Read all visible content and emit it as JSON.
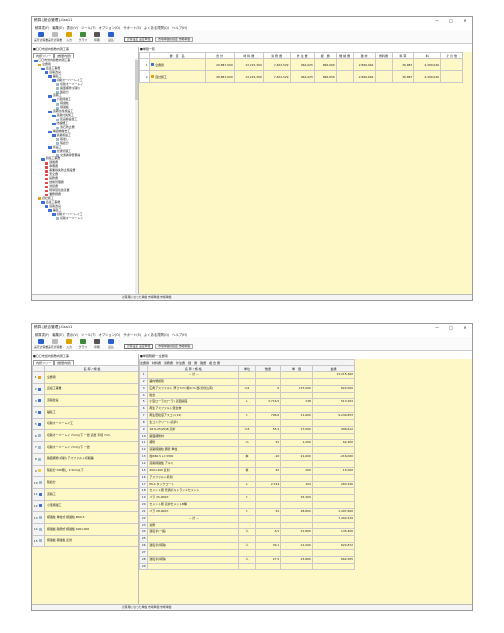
{
  "app": {
    "title": "積算-[統合管理]-Gsa11",
    "window_controls": [
      "—",
      "□",
      "✕"
    ],
    "menu": [
      "積算書(F)",
      "編集(E)",
      "表示(V)",
      "ツール(T)",
      "オプション(O)",
      "サポート(S)",
      "よくある質問(Q)",
      "ヘルプ(H)"
    ],
    "toolbar": [
      {
        "label": "実行計算書",
        "icon": "calc-icon"
      },
      {
        "label": "実行計算書",
        "icon": "undo-icon"
      },
      {
        "label": "入力",
        "icon": "pencil-icon"
      },
      {
        "label": "グラフ",
        "icon": "graph-icon"
      },
      {
        "label": "印刷",
        "icon": "print-icon"
      },
      {
        "label": "読込",
        "icon": "load-icon"
      }
    ],
    "box1": "計算設定\n設定単価",
    "box2": "市場単価の指定\n市場単価",
    "status": "計算用になった単価  市場単価  市場単価"
  },
  "left": {
    "header": "■〇〇市営内旗敷内測工事",
    "tab1": "内訳ツリー",
    "tab2": "[数量内訳]",
    "tree": [
      {
        "t": "〇〇市営内旗敷内測工事",
        "d": 0,
        "c": "c-blue"
      },
      {
        "t": "全費用",
        "d": 1,
        "c": "c-or"
      },
      {
        "t": "直接工事費",
        "d": 2,
        "c": "c-blue"
      },
      {
        "t": "道路改良",
        "d": 3,
        "c": "c-blue"
      },
      {
        "t": "舗装工",
        "d": 4,
        "c": "c-blue"
      },
      {
        "t": "切削オーバーレイ工",
        "d": 5,
        "c": "c-blue"
      },
      {
        "t": "切削オーバーレイ",
        "d": 6,
        "c": "c-gr"
      },
      {
        "t": "路面補修(切削)",
        "d": 6,
        "c": "c-gr"
      },
      {
        "t": "殻処分",
        "d": 6,
        "c": "c-gr"
      },
      {
        "t": "道路工",
        "d": 4,
        "c": "c-blue"
      },
      {
        "t": "小型標識工",
        "d": 5,
        "c": "c-blue"
      },
      {
        "t": "標識柱",
        "d": 6,
        "c": "c-gr"
      },
      {
        "t": "標識板",
        "d": 6,
        "c": "c-gr"
      },
      {
        "t": "道路付属施設工",
        "d": 4,
        "c": "c-blue"
      },
      {
        "t": "道路付属施工",
        "d": 5,
        "c": "c-blue"
      },
      {
        "t": "区画線設置工",
        "d": 6,
        "c": "c-gr"
      },
      {
        "t": "防護柵工",
        "d": 5,
        "c": "c-blue"
      },
      {
        "t": "落石防止柵",
        "d": 6,
        "c": "c-gr"
      },
      {
        "t": "構造物撤去工",
        "d": 4,
        "c": "c-blue"
      },
      {
        "t": "道路施設工",
        "d": 5,
        "c": "c-blue"
      },
      {
        "t": "取壊し",
        "d": 6,
        "c": "c-gr"
      },
      {
        "t": "殻処分",
        "d": 6,
        "c": "c-gr"
      },
      {
        "t": "仮設工",
        "d": 4,
        "c": "c-blue"
      },
      {
        "t": "交通管理工",
        "d": 5,
        "c": "c-blue"
      },
      {
        "t": "交通誘導警備員",
        "d": 6,
        "c": "c-gr"
      },
      {
        "t": "間接工事費",
        "d": 2,
        "c": "c-blue"
      },
      {
        "t": "運搬費",
        "d": 3,
        "c": "c-red"
      },
      {
        "t": "準備費",
        "d": 3,
        "c": "c-red"
      },
      {
        "t": "事業損失防止施設費",
        "d": 3,
        "c": "c-red"
      },
      {
        "t": "安全費",
        "d": 3,
        "c": "c-red"
      },
      {
        "t": "役務費",
        "d": 3,
        "c": "c-red"
      },
      {
        "t": "技術管理費",
        "d": 3,
        "c": "c-red"
      },
      {
        "t": "営繕費",
        "d": 3,
        "c": "c-red"
      },
      {
        "t": "現場環境改善費",
        "d": 3,
        "c": "c-red"
      },
      {
        "t": "業務経費",
        "d": 3,
        "c": "c-red"
      },
      {
        "t": "自社施工",
        "d": 1,
        "c": "c-or"
      },
      {
        "t": "直接工事費",
        "d": 2,
        "c": "c-blue"
      },
      {
        "t": "道路改良",
        "d": 3,
        "c": "c-blue"
      },
      {
        "t": "舗装工",
        "d": 4,
        "c": "c-blue"
      },
      {
        "t": "切削オーバーレイ工",
        "d": 5,
        "c": "c-blue"
      },
      {
        "t": "切削オーバーレイ",
        "d": 6,
        "c": "c-gr"
      }
    ]
  },
  "grid1": {
    "header": "■単価一覧",
    "cols": [
      "費　目　名",
      "合 計",
      "材 料 費",
      "労 務 費",
      "外 注 費",
      "経　費",
      "機 械 費",
      "雑 材",
      "燃料費",
      "料 算",
      "料",
      "そ の 他"
    ],
    "rows": [
      {
        "no": "1",
        "name": "全費用",
        "v": [
          "29,887,009",
          "13,215,300",
          "7,402,529",
          "962,625",
          "896,669",
          "",
          "2,896,662",
          "",
          "36,887",
          "4,399,040",
          ""
        ]
      },
      {
        "no": "2",
        "name": "自社施工",
        "v": [
          "28,887,009",
          "13,215,300",
          "7,402,529",
          "962,625",
          "896,659",
          "",
          "2,896,662",
          "",
          "36,887",
          "4,399,040",
          ""
        ]
      }
    ]
  },
  "w2": {
    "left_header": "■〇〇市営内旗敷内測工事",
    "right_header": "■単価明細一 全費用",
    "left_cols": [
      "名 称 / 規 格"
    ],
    "left_rows": [
      {
        "no": "1",
        "t": "全費用",
        "c": "c-or"
      },
      {
        "no": "2",
        "t": "直接工事費",
        "c": "c-blue"
      },
      {
        "no": "3",
        "t": "道路改良",
        "c": "c-blue"
      },
      {
        "no": "4",
        "t": "舗装工",
        "c": "c-blue"
      },
      {
        "no": "5",
        "t": "切削オーバーレイ工",
        "c": "c-blue"
      },
      {
        "no": "6",
        "t": "切削オーバーレイ 7cm以下 一層 表層 平坦 7cm",
        "c": "c-gr"
      },
      {
        "no": "7",
        "t": "切削オーバーレイ 7cm以下 一層",
        "c": "c-gr"
      },
      {
        "no": "8",
        "t": "路面補修(切削) アスファルト切削舗",
        "c": "c-gr"
      },
      {
        "no": "9",
        "t": "殻処分 DID無し 1.5km以下",
        "c": "c-yl"
      },
      {
        "no": "10",
        "t": "殻処分",
        "c": "c-gr"
      },
      {
        "no": "11",
        "t": "道路工",
        "c": "c-blue"
      },
      {
        "no": "12",
        "t": "小型標識工",
        "c": "c-blue"
      },
      {
        "no": "13",
        "t": "標識柱 単柱式 標識柱 Φ60.5",
        "c": "c-gr"
      },
      {
        "no": "14",
        "t": "標識板 路側式 標識板 400×400",
        "c": "c-gr"
      },
      {
        "no": "15",
        "t": "標識板 標識板 反射",
        "c": "c-gr"
      }
    ],
    "right_cols": [
      "全費用",
      "材料費",
      "労務費",
      "外注費",
      "経　費",
      "雑費",
      "複 合 費",
      "",
      "名 称 / 規 格",
      "単位",
      "数量",
      "単　価",
      "金額"
    ],
    "rows": [
      {
        "no": "1",
        "nm": "－ 計 －",
        "u": "",
        "q": "",
        "p": "",
        "a": "13,215,300"
      },
      {
        "no": "2",
        "nm": "舗内規模別",
        "u": "",
        "q": "",
        "p": "",
        "a": ""
      },
      {
        "no": "3",
        "nm": "広角アスファルト 厚さ7cm 幅2cm 層(切付込有)",
        "u": "m2",
        "q": "6",
        "p": "137,000",
        "a": "822,000"
      },
      {
        "no": "4",
        "nm": "粒合",
        "u": "",
        "q": "",
        "p": "",
        "a": ""
      },
      {
        "no": "5",
        "nm": "小型ローラ(ローラ) 表面締固",
        "u": "L",
        "q": "3,716.5",
        "p": "138",
        "a": "513,293"
      },
      {
        "no": "6",
        "nm": "再生アスファルト混合物",
        "u": "",
        "q": "",
        "p": "",
        "a": ""
      },
      {
        "no": "7",
        "nm": "再生密粒度アスコン(13)",
        "u": "t",
        "q": "796.6",
        "p": "11,600",
        "a": "9,240,853"
      },
      {
        "no": "8",
        "nm": "生コンクリート(高炉)",
        "u": "",
        "q": "",
        "p": "",
        "a": ""
      },
      {
        "no": "9",
        "nm": "18-8-25(20)B 高炉",
        "u": "m3",
        "q": "55.4",
        "p": "17,000",
        "a": "996,612"
      },
      {
        "no": "10",
        "nm": "路面補修材",
        "u": "",
        "q": "",
        "p": "",
        "a": ""
      },
      {
        "no": "11",
        "nm": "補修",
        "u": "m",
        "q": "52",
        "p": "1,200",
        "a": "62,400"
      },
      {
        "no": "12",
        "nm": "道路標識柱 鋼管 単柱",
        "u": "",
        "q": "",
        "p": "",
        "a": ""
      },
      {
        "no": "13",
        "nm": "柱Φ60.5 L=3300",
        "u": "本",
        "q": "-10",
        "p": "21,600",
        "a": "-216,000"
      },
      {
        "no": "14",
        "nm": "道路標識板 アルミ",
        "u": "",
        "q": "",
        "p": "",
        "a": ""
      },
      {
        "no": "15",
        "nm": "400×400 反射",
        "u": "枚",
        "q": "50",
        "p": "300",
        "a": "15,000"
      },
      {
        "no": "16",
        "nm": "アスファルト乳剤",
        "u": "",
        "q": "",
        "p": "",
        "a": ""
      },
      {
        "no": "17",
        "nm": "PK-4 タックコート",
        "u": "L",
        "q": "2,724",
        "p": "104",
        "a": "283,346"
      },
      {
        "no": "18",
        "nm": "セメント類 普通ポルトランドセメント",
        "u": "",
        "q": "",
        "p": "",
        "a": ""
      },
      {
        "no": "19",
        "nm": "バラ 25,000/t",
        "u": "t",
        "q": "",
        "p": "25,300",
        "a": ""
      },
      {
        "no": "20",
        "nm": "セメント類 高炉セメントB種",
        "u": "",
        "q": "",
        "p": "",
        "a": ""
      },
      {
        "no": "21",
        "nm": "バラ 28,000/t",
        "u": "t",
        "q": "52",
        "p": "28,800",
        "a": "1,497,600"
      },
      {
        "no": "22",
        "nm": "－ 計 －",
        "u": "",
        "q": "",
        "p": "",
        "a": "7,402,529"
      },
      {
        "no": "23",
        "nm": "労務",
        "u": "",
        "q": "",
        "p": "",
        "a": ""
      },
      {
        "no": "24",
        "nm": "運転手(一般)",
        "u": "人",
        "q": "6.5",
        "p": "21,800",
        "a": "145,400"
      },
      {
        "no": "25",
        "nm": "",
        "u": "",
        "q": "",
        "p": "",
        "a": ""
      },
      {
        "no": "26",
        "nm": "運転手(特殊)",
        "u": "人",
        "q": "39.1",
        "p": "21,000",
        "a": "822,872"
      },
      {
        "no": "27",
        "nm": "",
        "u": "",
        "q": "",
        "p": "",
        "a": ""
      },
      {
        "no": "28",
        "nm": "運転手(特殊)",
        "u": "人",
        "q": "27.5",
        "p": "23,800",
        "a": "662,505"
      },
      {
        "no": "29",
        "nm": "",
        "u": "",
        "q": "",
        "p": "",
        "a": ""
      }
    ]
  }
}
